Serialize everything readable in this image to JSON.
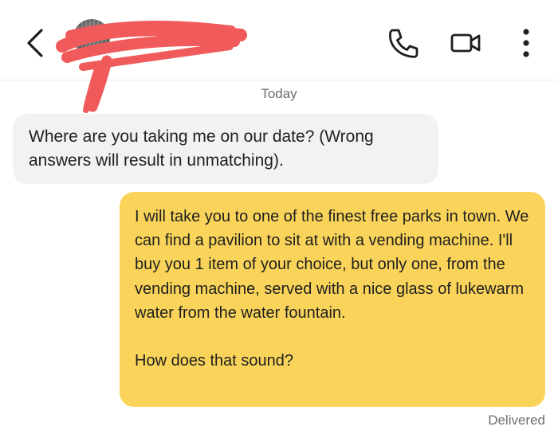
{
  "header": {
    "contact_name": "",
    "icons": {
      "back": "chevron-left-icon",
      "phone": "phone-icon",
      "video": "video-camera-icon",
      "more": "more-vertical-icon"
    }
  },
  "conversation": {
    "date_separator": "Today",
    "messages": [
      {
        "direction": "incoming",
        "text": "Where are you taking me on our date? (Wrong answers will result in unmatching)."
      },
      {
        "direction": "outgoing",
        "text": "I will take you to one of the finest free parks in town. We can find a pavilion to sit at with a vending machine. I'll buy you 1 item of your choice, but only one, from the vending machine, served with a nice glass of lukewarm water from the water fountain.\n\nHow does that sound?"
      }
    ],
    "status": "Delivered"
  },
  "colors": {
    "incoming_bubble": "#f2f2f2",
    "outgoing_bubble": "#fad45a",
    "redaction": "#f05a5a"
  }
}
